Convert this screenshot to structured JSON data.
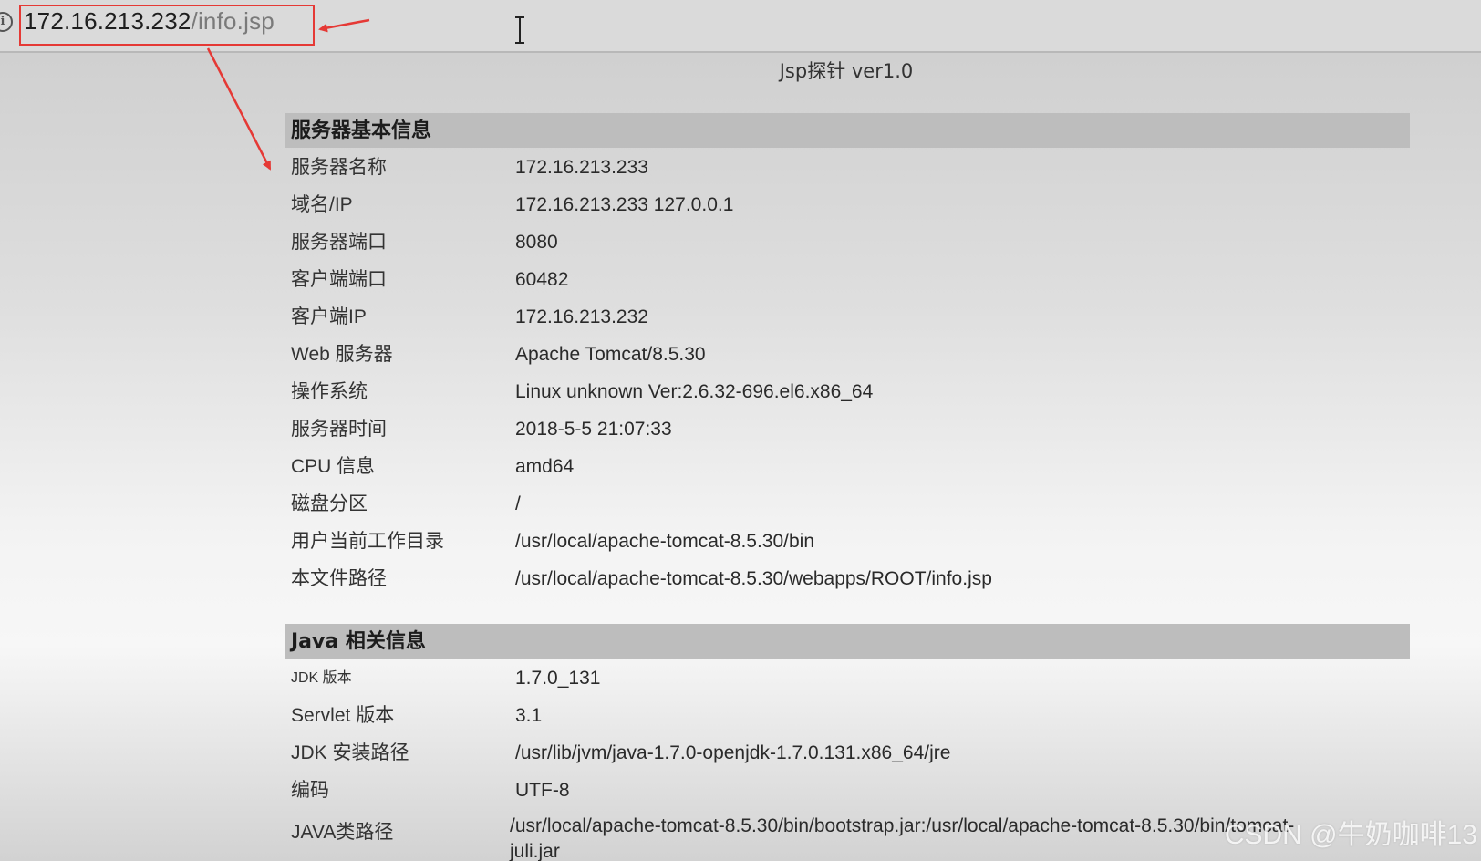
{
  "address_bar": {
    "url_host": "172.16.213.232",
    "url_path": "/info.jsp",
    "info_icon_glyph": "i"
  },
  "page_title": "Jsp探针 ver1.0",
  "server_section": {
    "header": "服务器基本信息",
    "rows": [
      {
        "label": "服务器名称",
        "value": "172.16.213.233"
      },
      {
        "label": "域名/IP",
        "value": "172.16.213.233 127.0.0.1"
      },
      {
        "label": "服务器端口",
        "value": "8080"
      },
      {
        "label": "客户端端口",
        "value": "60482"
      },
      {
        "label": "客户端IP",
        "value": "172.16.213.232"
      },
      {
        "label": "Web 服务器",
        "value": "Apache Tomcat/8.5.30"
      },
      {
        "label": "操作系统",
        "value": "Linux unknown Ver:2.6.32-696.el6.x86_64"
      },
      {
        "label": "服务器时间",
        "value": "2018-5-5 21:07:33"
      },
      {
        "label": "CPU 信息",
        "value": "amd64"
      },
      {
        "label": "磁盘分区",
        "value": "/"
      },
      {
        "label": "用户当前工作目录",
        "value": "/usr/local/apache-tomcat-8.5.30/bin"
      },
      {
        "label": "本文件路径",
        "value": "/usr/local/apache-tomcat-8.5.30/webapps/ROOT/info.jsp"
      }
    ]
  },
  "java_section": {
    "header": "Java 相关信息",
    "rows": [
      {
        "label": "JDK 版本",
        "value": "1.7.0_131"
      },
      {
        "label": "Servlet 版本",
        "value": "3.1"
      },
      {
        "label": "JDK 安装路径",
        "value": "/usr/lib/jvm/java-1.7.0-openjdk-1.7.0.131.x86_64/jre"
      },
      {
        "label": "编码",
        "value": "UTF-8"
      },
      {
        "label": "JAVA类路径",
        "value": "/usr/local/apache-tomcat-8.5.30/bin/bootstrap.jar:/usr/local/apache-tomcat-8.5.30/bin/tomcat-\njuli.jar"
      }
    ]
  },
  "watermark": "CSDN @牛奶咖啡13",
  "colors": {
    "annotation_red": "#e53935",
    "section_header_bg": "#bdbdbd"
  }
}
